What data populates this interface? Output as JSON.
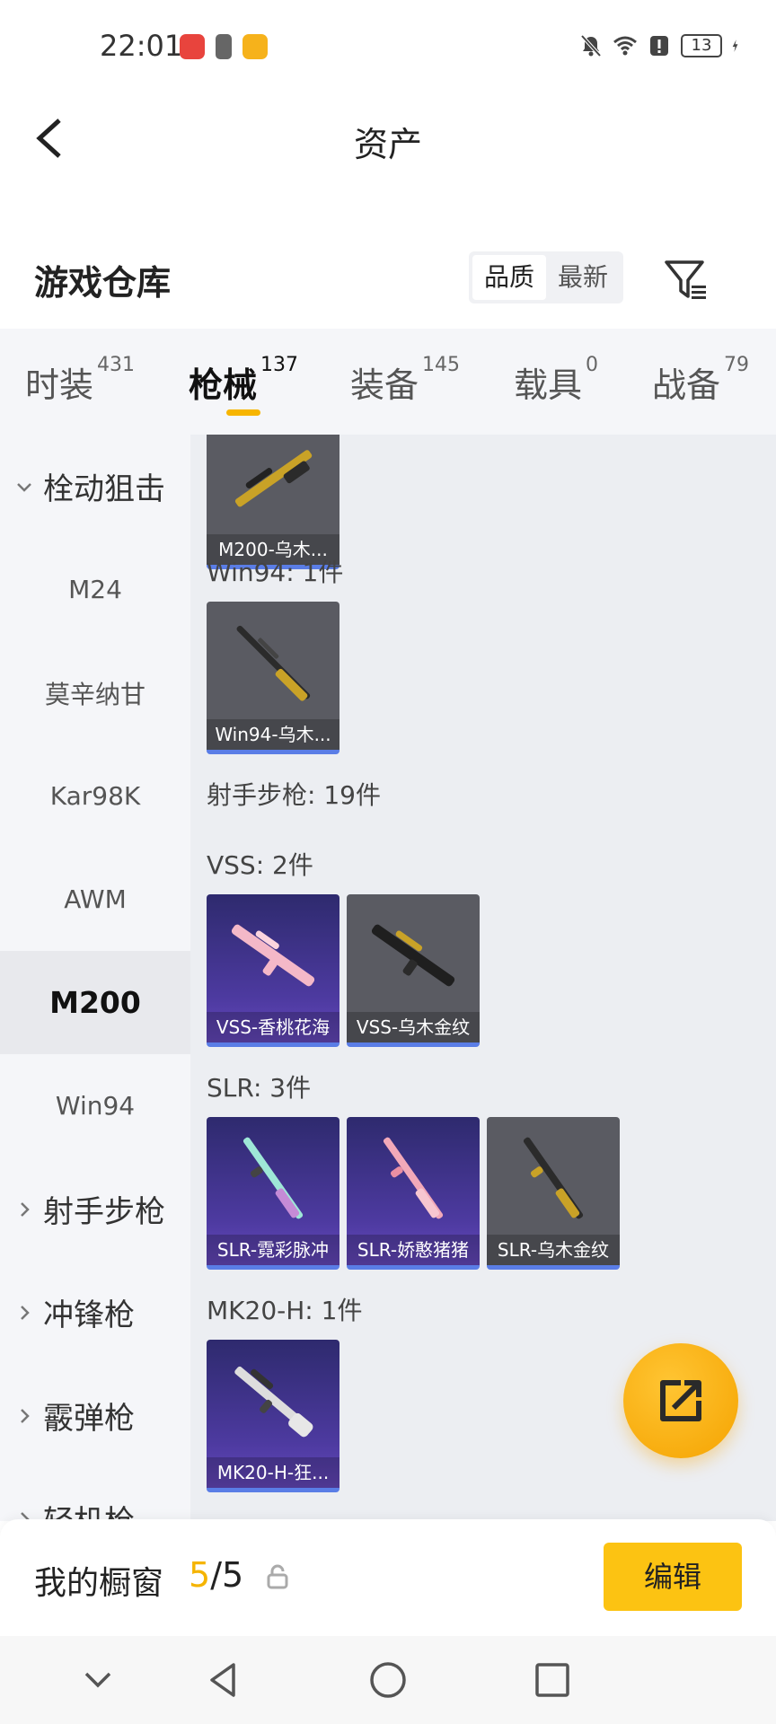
{
  "status_bar": {
    "time": "22:01",
    "battery": "13"
  },
  "header": {
    "title": "资产"
  },
  "warehouse": {
    "title": "游戏仓库",
    "sort_quality": "品质",
    "sort_latest": "最新"
  },
  "tabs": [
    {
      "label": "时装",
      "count": "431"
    },
    {
      "label": "枪械",
      "count": "137"
    },
    {
      "label": "装备",
      "count": "145"
    },
    {
      "label": "载具",
      "count": "0"
    },
    {
      "label": "战备",
      "count": "79"
    }
  ],
  "sidebar": {
    "items": [
      {
        "label": "栓动狙击"
      },
      {
        "label": "M24"
      },
      {
        "label": "莫辛纳甘"
      },
      {
        "label": "Kar98K"
      },
      {
        "label": "AWM"
      },
      {
        "label": "M200"
      },
      {
        "label": "Win94"
      },
      {
        "label": "射手步枪"
      },
      {
        "label": "冲锋枪"
      },
      {
        "label": "霰弹枪"
      },
      {
        "label": "轻机枪"
      }
    ]
  },
  "content": {
    "sections": [
      {
        "label": "Win94: 1件"
      },
      {
        "label": "射手步枪: 19件"
      },
      {
        "label": "VSS: 2件"
      },
      {
        "label": "SLR: 3件"
      },
      {
        "label": "MK20-H: 1件"
      }
    ],
    "cards": [
      {
        "name": "M200-乌木..."
      },
      {
        "name": "Win94-乌木..."
      },
      {
        "name": "VSS-香桃花海"
      },
      {
        "name": "VSS-乌木金纹"
      },
      {
        "name": "SLR-霓彩脉冲"
      },
      {
        "name": "SLR-娇憨猪猪"
      },
      {
        "name": "SLR-乌木金纹"
      },
      {
        "name": "MK20-H-狂..."
      }
    ]
  },
  "showcase": {
    "title": "我的橱窗",
    "count_current": "5",
    "count_sep": "/",
    "count_total": "5",
    "edit_label": "编辑"
  },
  "colors": {
    "accent": "#f7b500",
    "card_rare": "#4d3aa0",
    "card_border": "#5a7de6"
  }
}
